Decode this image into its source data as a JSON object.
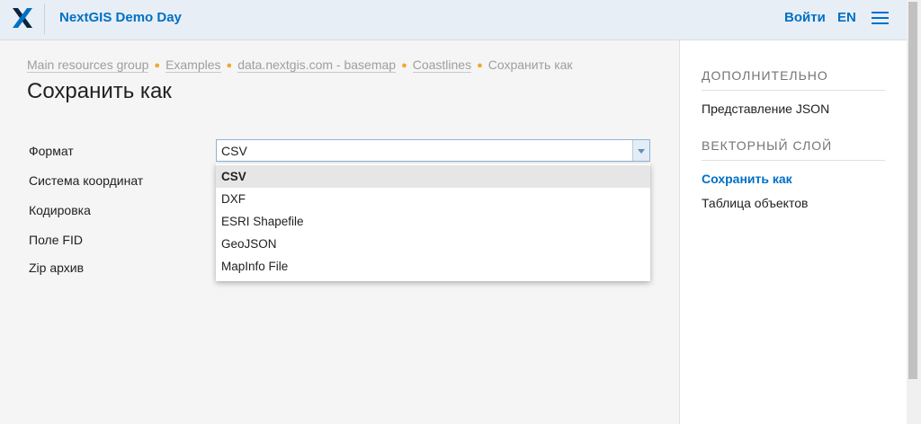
{
  "header": {
    "app_title": "NextGIS Demo Day",
    "login_label": "Войти",
    "language": "EN",
    "logo_icon": "nextgis-x-logo-icon",
    "menu_icon": "hamburger-menu-icon"
  },
  "breadcrumb": {
    "items": [
      "Main resources group",
      "Examples",
      "data.nextgis.com - basemap",
      "Coastlines"
    ],
    "current": "Сохранить как"
  },
  "page": {
    "title": "Сохранить как"
  },
  "form": {
    "labels": {
      "format": "Формат",
      "crs": "Система координат",
      "encoding": "Кодировка",
      "fid_field": "Поле FID",
      "zip": "Zip архив"
    },
    "format_value": "CSV",
    "format_options": [
      "CSV",
      "DXF",
      "ESRI Shapefile",
      "GeoJSON",
      "MapInfo File"
    ]
  },
  "sidebar": {
    "section1_heading": "ДОПОЛНИТЕЛЬНО",
    "section1_items": [
      "Представление JSON"
    ],
    "section2_heading": "ВЕКТОРНЫЙ СЛОЙ",
    "section2_items": [
      "Сохранить как",
      "Таблица объектов"
    ]
  },
  "colors": {
    "accent": "#0070c5",
    "header_bg": "#e8eef6",
    "breadcrumb_dot": "#f0a830"
  }
}
